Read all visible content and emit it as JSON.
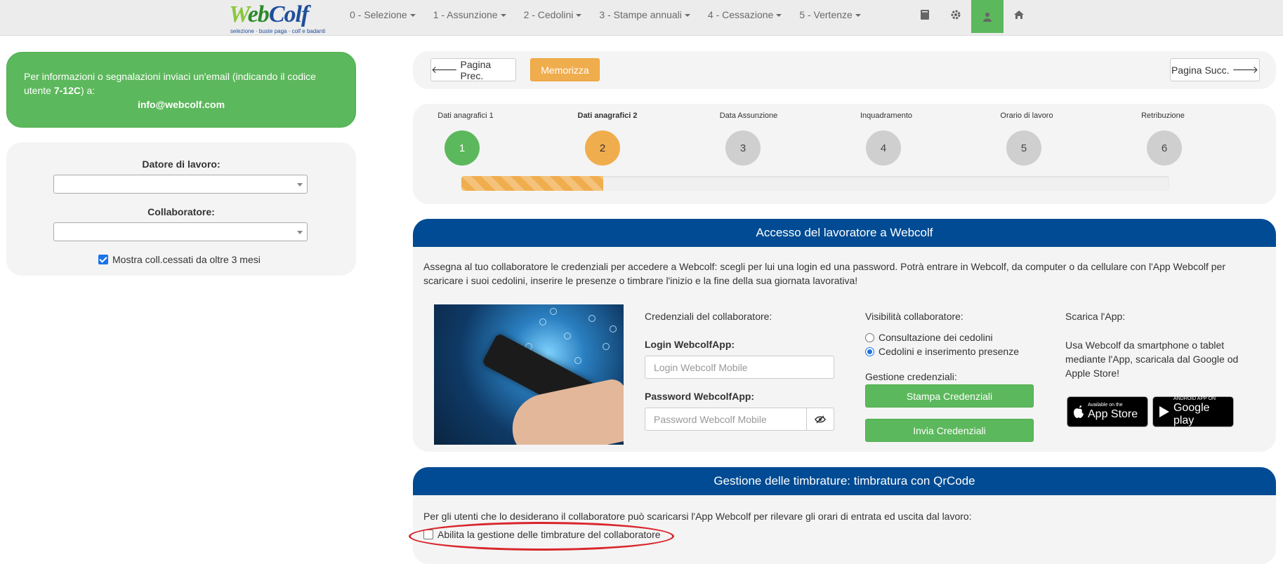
{
  "navbar": {
    "logo_text_w": "W",
    "logo_text_eb": "eb",
    "logo_text_colf": "Colf",
    "logo_tagline": "selezione · buste paga · colf e badanti",
    "menu": [
      {
        "label": "0 - Selezione"
      },
      {
        "label": "1 - Assunzione"
      },
      {
        "label": "2 - Cedolini"
      },
      {
        "label": "3 - Stampe annuali"
      },
      {
        "label": "4 - Cessazione"
      },
      {
        "label": "5 - Vertenze"
      }
    ],
    "icons": [
      "book-icon",
      "gear-icon",
      "user-icon",
      "home-icon"
    ],
    "user_highlight_color": "#5cb85c"
  },
  "info": {
    "text_prefix": "Per informazioni o segnalazioni inviaci un'email (indicando il codice utente ",
    "user_code": "7-12C",
    "text_suffix": ") a:",
    "email": "info@webcolf.com"
  },
  "selection": {
    "employer_label": "Datore di lavoro:",
    "employer_value": "",
    "collaborator_label": "Collaboratore:",
    "collaborator_value": "",
    "show_ceased_label": "Mostra coll.cessati da oltre 3 mesi",
    "show_ceased_checked": true
  },
  "toolbar": {
    "prev_label": "Pagina Prec.",
    "save_label": "Memorizza",
    "next_label": "Pagina Succ."
  },
  "wizard": {
    "steps": [
      {
        "label": "Dati anagrafici 1",
        "number": "1",
        "state": "done"
      },
      {
        "label": "Dati anagrafici 2",
        "number": "2",
        "state": "current"
      },
      {
        "label": "Data Assunzione",
        "number": "3",
        "state": "todo"
      },
      {
        "label": "Inquadramento",
        "number": "4",
        "state": "todo"
      },
      {
        "label": "Orario di lavoro",
        "number": "5",
        "state": "todo"
      },
      {
        "label": "Retribuzione",
        "number": "6",
        "state": "todo"
      }
    ],
    "progress_fraction": 0.2
  },
  "access": {
    "title": "Accesso del lavoratore a Webcolf",
    "description": "Assegna al tuo collaboratore le credenziali per accedere a Webcolf: scegli per lui una login ed una password. Potrà entrare in Webcolf, da computer o da cellulare con l'App Webcolf per scaricare i suoi cedolini, inserire le presenze o timbrare l'inizio e la fine della sua giornata lavorativa!",
    "credentials_title": "Credenziali del collaboratore:",
    "login_label": "Login WebcolfApp:",
    "login_placeholder": "Login Webcolf Mobile",
    "password_label": "Password WebcolfApp:",
    "password_placeholder": "Password Webcolf Mobile",
    "visibility_title": "Visibilità collaboratore:",
    "visibility_options": [
      {
        "label": "Consultazione dei cedolini",
        "selected": false
      },
      {
        "label": "Cedolini e inserimento presenze",
        "selected": true
      }
    ],
    "manage_title": "Gestione credenziali:",
    "print_button": "Stampa Credenziali",
    "send_button": "Invia Credenziali",
    "download_title": "Scarica l'App:",
    "download_text": "Usa Webcolf da smartphone o tablet mediante l'App, scaricala dal Google od Apple Store!",
    "appstore_small": "Available on the",
    "appstore_big": "App Store",
    "googleplay_small": "ANDROID APP ON",
    "googleplay_big": "Google play"
  },
  "qrcode": {
    "title": "Gestione delle timbrature: timbratura con QrCode",
    "description": "Per gli utenti che lo desiderano il collaboratore può scaricarsi l'App Webcolf per rilevare gli orari di entrata ed uscita dal lavoro:",
    "enable_label": "Abilita la gestione delle timbrature del collaboratore",
    "enable_checked": false
  },
  "colors": {
    "success": "#5cb85c",
    "warning": "#f0ad4e",
    "primary_header": "#004b93",
    "annotation": "#d9262c"
  }
}
